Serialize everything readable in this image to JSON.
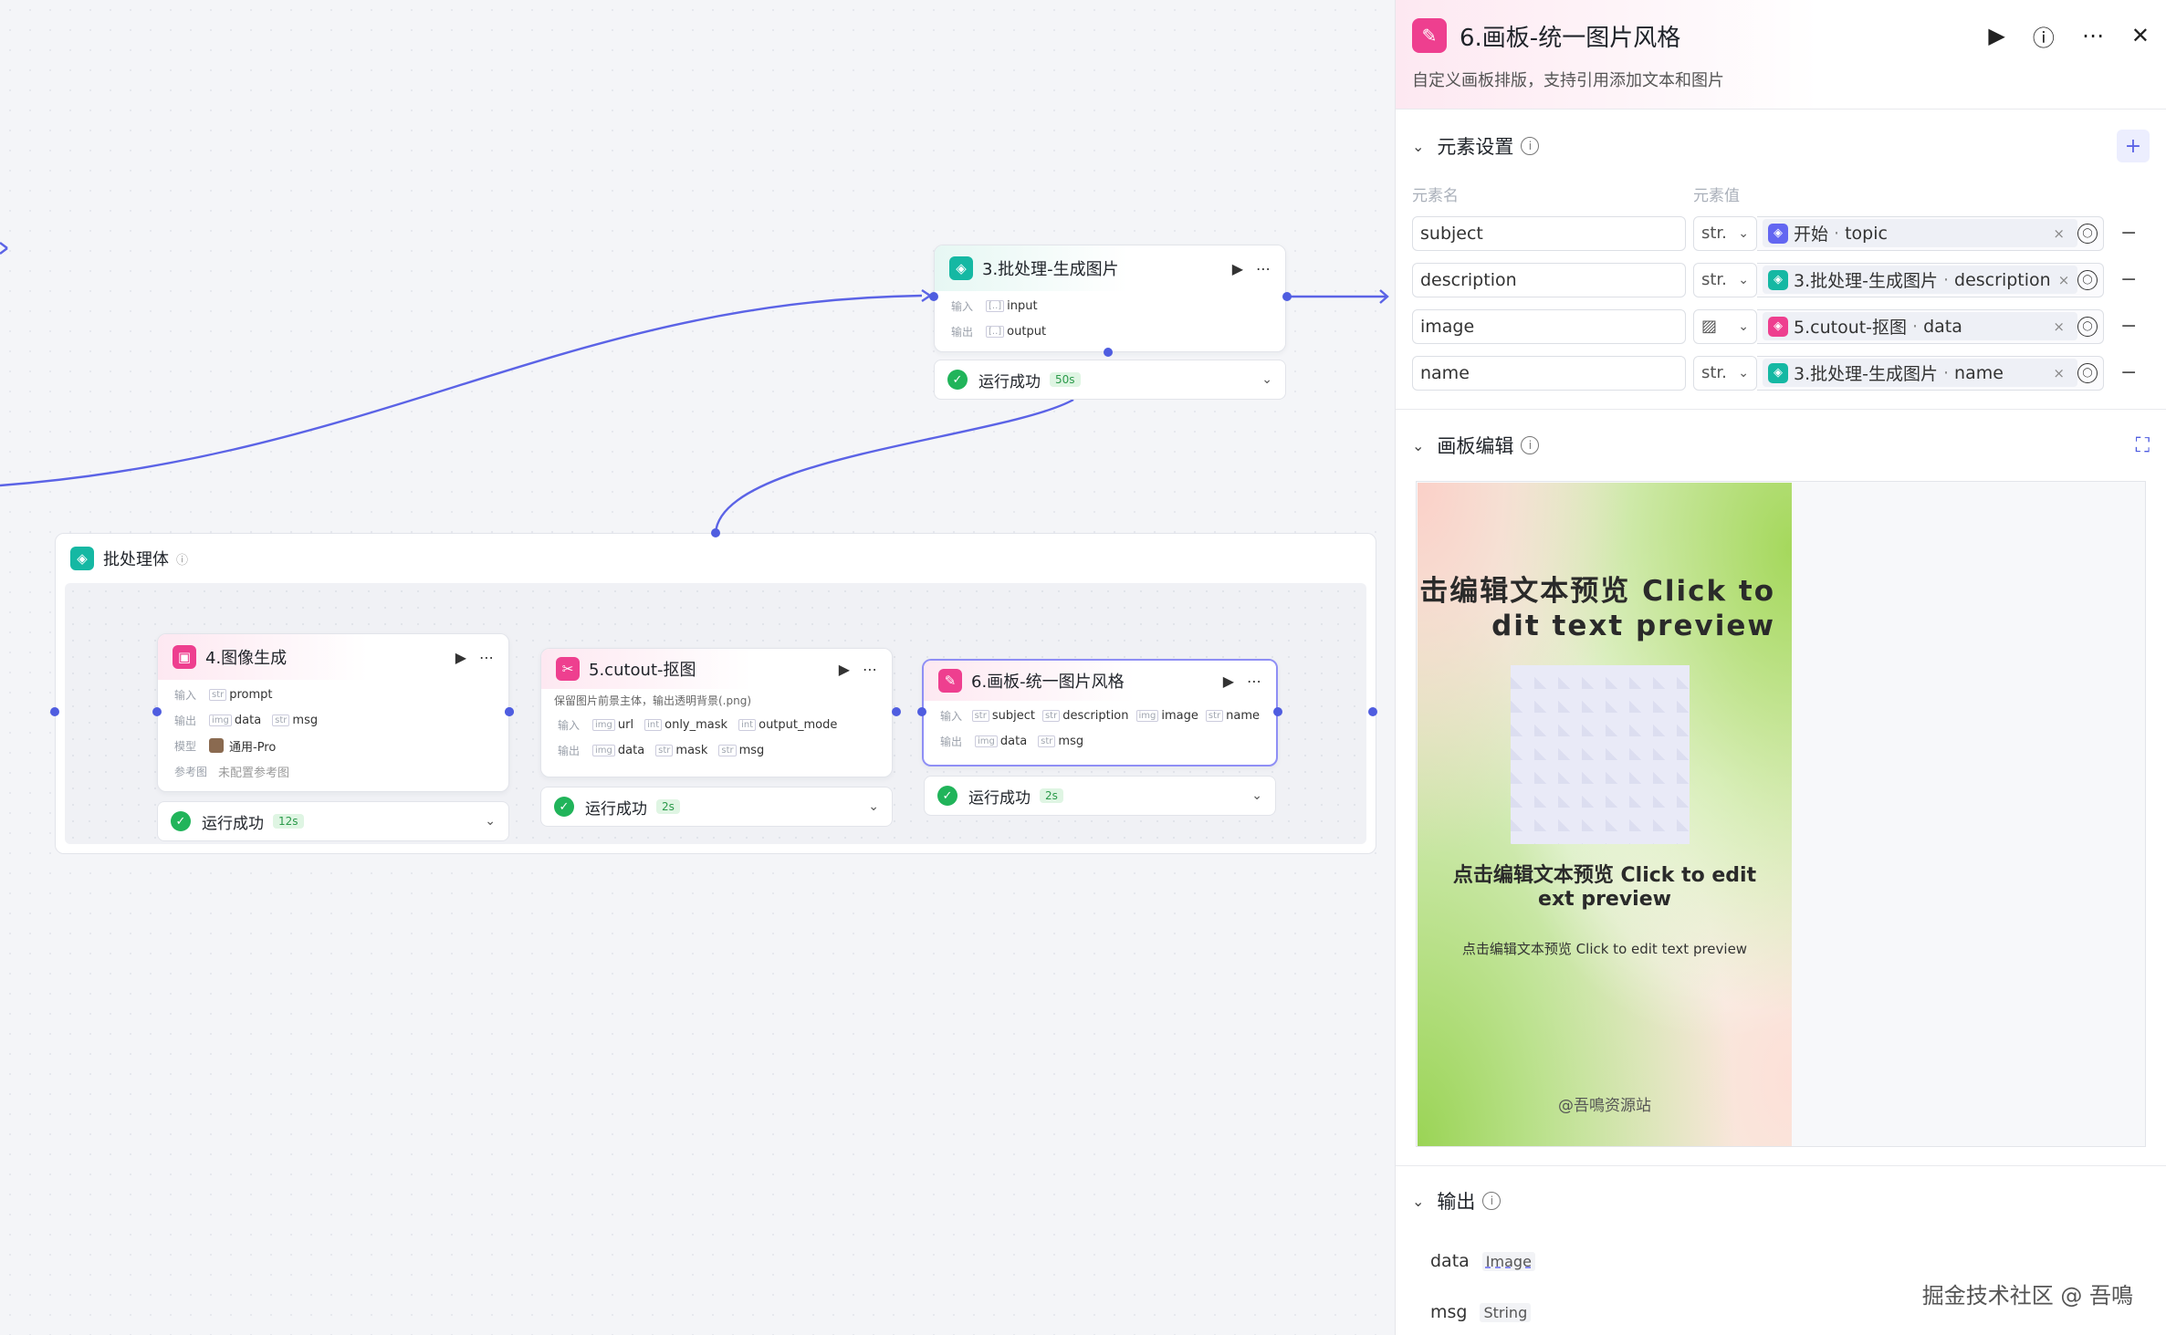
{
  "canvas": {
    "group": {
      "title": "批处理体"
    },
    "node3": {
      "title": "3.批处理-生成图片",
      "in_label": "输入",
      "out_label": "输出",
      "inputs": [
        "input"
      ],
      "outputs": [
        "output"
      ],
      "status": "运行成功",
      "time": "50s"
    },
    "node4": {
      "title": "4.图像生成",
      "in_label": "输入",
      "out_label": "输出",
      "model_label": "模型",
      "ref_label": "参考图",
      "inputs": [
        {
          "type": "str",
          "name": "prompt"
        }
      ],
      "outputs": [
        {
          "type": "img",
          "name": "data"
        },
        {
          "type": "str",
          "name": "msg"
        }
      ],
      "model": "通用-Pro",
      "ref": "未配置参考图",
      "status": "运行成功",
      "time": "12s"
    },
    "node5": {
      "title": "5.cutout-抠图",
      "desc": "保留图片前景主体，输出透明背景(.png)",
      "in_label": "输入",
      "out_label": "输出",
      "inputs": [
        {
          "type": "img",
          "name": "url"
        },
        {
          "type": "int",
          "name": "only_mask"
        },
        {
          "type": "int",
          "name": "output_mode"
        }
      ],
      "outputs": [
        {
          "type": "img",
          "name": "data"
        },
        {
          "type": "str",
          "name": "mask"
        },
        {
          "type": "str",
          "name": "msg"
        }
      ],
      "status": "运行成功",
      "time": "2s"
    },
    "node6": {
      "title": "6.画板-统一图片风格",
      "in_label": "输入",
      "out_label": "输出",
      "inputs": [
        {
          "type": "str",
          "name": "subject"
        },
        {
          "type": "str",
          "name": "description"
        },
        {
          "type": "img",
          "name": "image"
        },
        {
          "type": "str",
          "name": "name"
        }
      ],
      "outputs": [
        {
          "type": "img",
          "name": "data"
        },
        {
          "type": "str",
          "name": "msg"
        }
      ],
      "status": "运行成功",
      "time": "2s"
    }
  },
  "panel": {
    "title": "6.画板-统一图片风格",
    "subtitle": "自定义画板排版，支持引用添加文本和图片",
    "elements_section": "元素设置",
    "col_name": "元素名",
    "col_value": "元素值",
    "elements": [
      {
        "name": "subject",
        "type": "str.",
        "ref_node": "开始",
        "ref_field": "topic",
        "ref_color": "#6366f1"
      },
      {
        "name": "description",
        "type": "str.",
        "ref_node": "3.批处理-生成图片",
        "ref_field": "description",
        "ref_color": "#15b8a3"
      },
      {
        "name": "image",
        "type": "image-icon",
        "ref_node": "5.cutout-抠图",
        "ref_field": "data",
        "ref_color": "#ee3f8f"
      },
      {
        "name": "name",
        "type": "str.",
        "ref_node": "3.批处理-生成图片",
        "ref_field": "name",
        "ref_color": "#15b8a3"
      }
    ],
    "canvas_section": "画板编辑",
    "preview": {
      "big_line1": "点击编辑文本预览 Click to",
      "big_line2": "dit text preview",
      "mid_line1": "点击编辑文本预览 Click to edit",
      "mid_line2": "ext preview",
      "small": "点击编辑文本预览 Click to edit text preview",
      "signature": "@吾鳴资源站"
    },
    "output_section": "输出",
    "outputs": [
      {
        "name": "data",
        "type": "Image"
      },
      {
        "name": "msg",
        "type": "String"
      }
    ]
  },
  "watermark": "掘金技术社区 @ 吾鳴",
  "colors": {
    "accent": "#4f5de0",
    "teal": "#15b8a3",
    "pink": "#ee3f8f",
    "success": "#21b45a"
  }
}
